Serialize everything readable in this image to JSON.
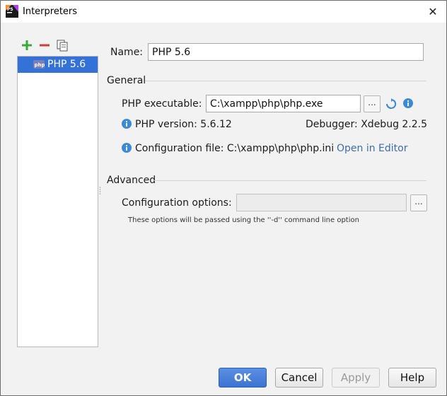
{
  "window": {
    "title": "Interpreters",
    "close_glyph": "✕"
  },
  "left_panel": {
    "toolbar": {
      "add_icon": "plus-icon",
      "remove_icon": "minus-icon",
      "copy_icon": "copy-icon"
    },
    "interpreters": [
      {
        "label": "PHP 5.6",
        "selected": true
      }
    ]
  },
  "form": {
    "name_label": "Name:",
    "name_value": "PHP 5.6",
    "general_section": "General",
    "php_executable_label": "PHP executable:",
    "php_executable_value": "C:\\xampp\\php\\php.exe",
    "browse_label": "...",
    "php_version_text": "PHP version: 5.6.12",
    "debugger_text": "Debugger: Xdebug 2.2.5",
    "config_file_text": "Configuration file: C:\\xampp\\php\\php.ini",
    "open_in_editor_link": "Open in Editor",
    "advanced_section": "Advanced",
    "config_options_label": "Configuration options:",
    "config_options_value": "",
    "config_options_browse": "...",
    "config_options_hint": "These options will be passed using the ''-d'' command line option"
  },
  "buttons": {
    "ok": "OK",
    "cancel": "Cancel",
    "apply": "Apply",
    "help": "Help"
  },
  "colors": {
    "accent": "#3572d8",
    "link": "#3e6ea8",
    "add_green": "#3ba83b",
    "remove_red": "#d23b3b",
    "info_blue": "#3b8ad8"
  }
}
